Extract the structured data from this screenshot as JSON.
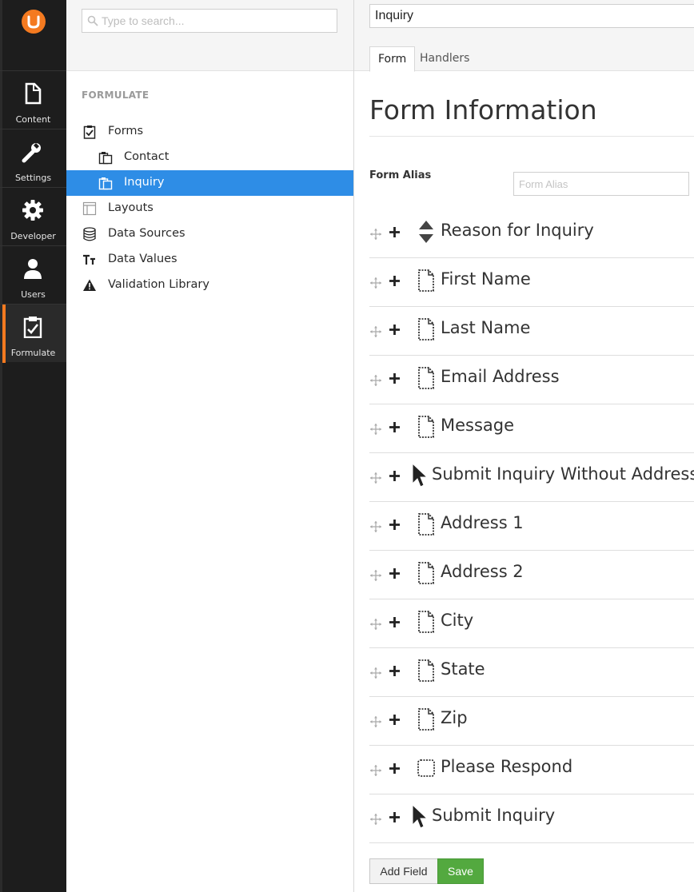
{
  "appbar": {
    "sections": [
      {
        "label": "Content",
        "icon": "document-icon"
      },
      {
        "label": "Settings",
        "icon": "wrench-icon"
      },
      {
        "label": "Developer",
        "icon": "gear-icon"
      },
      {
        "label": "Users",
        "icon": "user-icon"
      },
      {
        "label": "Formulate",
        "icon": "clipboard-check-icon",
        "active": true
      }
    ],
    "accent": "#f47a20"
  },
  "tree": {
    "search_placeholder": "Type to search...",
    "title": "FORMULATE",
    "items": [
      {
        "label": "Forms",
        "icon": "clipboard-check-icon"
      },
      {
        "label": "Contact",
        "icon": "clipboard-icon"
      },
      {
        "label": "Inquiry",
        "icon": "clipboard-icon",
        "selected": true
      },
      {
        "label": "Layouts",
        "icon": "layout-icon"
      },
      {
        "label": "Data Sources",
        "icon": "database-icon"
      },
      {
        "label": "Data Values",
        "icon": "text-size-icon"
      },
      {
        "label": "Validation Library",
        "icon": "warning-icon"
      }
    ],
    "selected_color": "#2e8de6"
  },
  "editor": {
    "name_value": "Inquiry",
    "tabs": [
      "Form",
      "Handlers"
    ],
    "active_tab": "Form",
    "title": "Form Information",
    "alias_label": "Form Alias",
    "alias_placeholder": "Form Alias",
    "fields": [
      {
        "label": "Reason for Inquiry",
        "icon": "sort-arrows-icon"
      },
      {
        "label": "First Name",
        "icon": "document-dotted-icon"
      },
      {
        "label": "Last Name",
        "icon": "document-dotted-icon"
      },
      {
        "label": "Email Address",
        "icon": "document-dotted-icon"
      },
      {
        "label": "Message",
        "icon": "document-dotted-icon"
      },
      {
        "label": "Submit Inquiry Without Address",
        "icon": "cursor-icon"
      },
      {
        "label": "Address 1",
        "icon": "document-dotted-icon"
      },
      {
        "label": "Address 2",
        "icon": "document-dotted-icon"
      },
      {
        "label": "City",
        "icon": "document-dotted-icon"
      },
      {
        "label": "State",
        "icon": "document-dotted-icon"
      },
      {
        "label": "Zip",
        "icon": "document-dotted-icon"
      },
      {
        "label": "Please Respond",
        "icon": "checkbox-dotted-icon"
      },
      {
        "label": "Submit Inquiry",
        "icon": "cursor-icon"
      }
    ],
    "add_field_label": "Add Field",
    "save_label": "Save",
    "save_color": "#53a93f"
  }
}
